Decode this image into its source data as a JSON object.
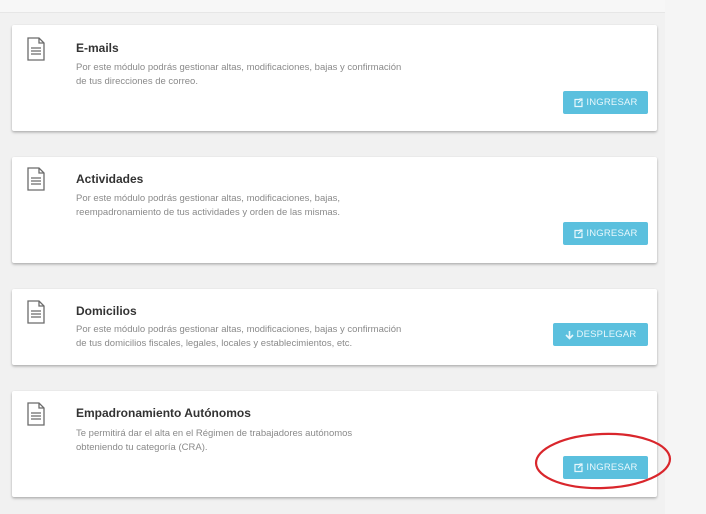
{
  "modules": [
    {
      "title": "E-mails",
      "description_line1": "Por este módulo podrás gestionar altas, modificaciones, bajas y confirmación",
      "description_line2": "de tus direcciones de correo.",
      "button_label": "INGRESAR",
      "button_icon": "external-edit-icon"
    },
    {
      "title": "Actividades",
      "description_line1": "Por este módulo podrás gestionar altas, modificaciones, bajas,",
      "description_line2": "reempadronamiento de tus actividades y orden de las mismas.",
      "button_label": "INGRESAR",
      "button_icon": "external-edit-icon"
    },
    {
      "title": "Domicilios",
      "description_line1": "Por este módulo podrás gestionar altas, modificaciones, bajas y confirmación",
      "description_line2": "de tus domicilios fiscales, legales, locales y establecimientos, etc.",
      "button_label": "DESPLEGAR",
      "button_icon": "arrow-down-icon"
    },
    {
      "title": "Empadronamiento Autónomos",
      "description_line1": "Te permitirá dar el alta en el Régimen de trabajadores autónomos",
      "description_line2": "obteniendo tu categoría (CRA).",
      "button_label": "INGRESAR",
      "button_icon": "external-edit-icon"
    }
  ],
  "colors": {
    "button": "#5bc0de",
    "highlight_ring": "#d9262c",
    "title": "#333333",
    "description": "#8a8a8a"
  }
}
